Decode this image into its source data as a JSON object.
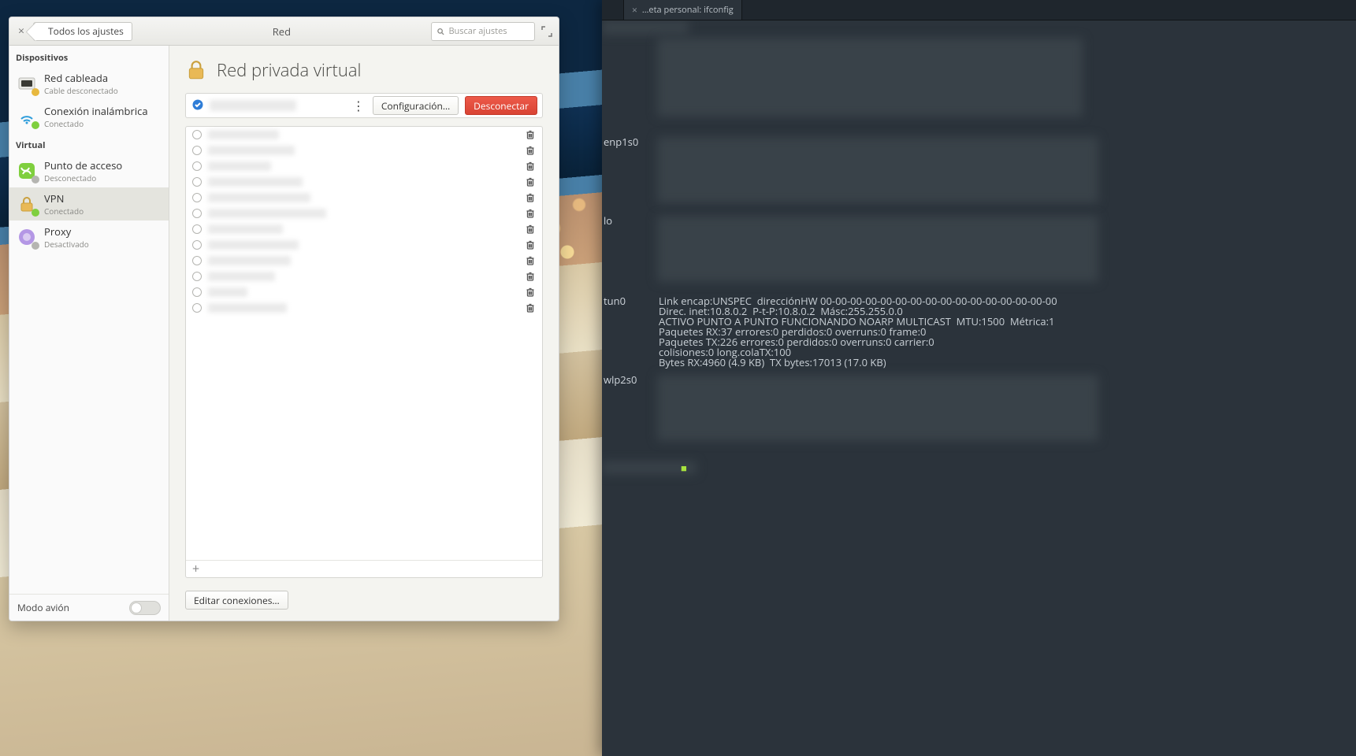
{
  "wallpaper": {
    "style": "bokeh-landscape"
  },
  "network_window": {
    "headerbar": {
      "close_glyph": "×",
      "back_label": "Todos los ajustes",
      "title": "Red",
      "search_placeholder": "Buscar ajustes",
      "maximize_tooltip": "Maximizar"
    },
    "sidebar": {
      "group_devices": "Dispositivos",
      "group_virtual": "Virtual",
      "items": [
        {
          "id": "wired",
          "name": "Red cableada",
          "sub": "Cable desconectado",
          "group": "devices",
          "icon": "ethernet",
          "badge": "#e7b83e"
        },
        {
          "id": "wifi",
          "name": "Conexión inalámbrica",
          "sub": "Conectado",
          "group": "devices",
          "icon": "wifi",
          "badge": "#7fcf3e"
        },
        {
          "id": "hotspot",
          "name": "Punto de acceso",
          "sub": "Desconectado",
          "group": "virtual",
          "icon": "hotspot",
          "badge": "#b5b5b1"
        },
        {
          "id": "vpn",
          "name": "VPN",
          "sub": "Conectado",
          "group": "virtual",
          "icon": "lock",
          "badge": "#7fcf3e",
          "selected": true
        },
        {
          "id": "proxy",
          "name": "Proxy",
          "sub": "Desactivado",
          "group": "virtual",
          "icon": "proxy",
          "badge": "#b5b5b1"
        }
      ],
      "airplane_label": "Modo avión",
      "airplane_on": false
    },
    "main": {
      "page_title": "Red privada virtual",
      "active_connection": {
        "checked": true,
        "name_obscured": true
      },
      "menu_dots_glyph": "⋮",
      "config_button": "Configuración…",
      "disconnect_button": "Desconectar",
      "vpn_rows_count": 12,
      "add_glyph": "+",
      "edit_connections": "Editar conexiones…"
    }
  },
  "terminal_window": {
    "tabs": {
      "title": "…eta personal: ifconfig",
      "close_glyph": "×",
      "new_glyph": "+"
    },
    "interfaces": {
      "enp1s0": "enp1s0",
      "lo": "lo",
      "tun0": "tun0",
      "wlp2s0": "wlp2s0"
    },
    "tun0_lines": [
      "Link encap:UNSPEC  direcciónHW 00-00-00-00-00-00-00-00-00-00-00-00-00-00-00-00",
      "Direc. inet:10.8.0.2  P-t-P:10.8.0.2  Másc:255.255.0.0",
      "ACTIVO PUNTO A PUNTO FUNCIONANDO NOARP MULTICAST  MTU:1500  Métrica:1",
      "Paquetes RX:37 errores:0 perdidos:0 overruns:0 frame:0",
      "Paquetes TX:226 errores:0 perdidos:0 overruns:0 carrier:0",
      "colisiones:0 long.colaTX:100",
      "Bytes RX:4960 (4.9 KB)  TX bytes:17013 (17.0 KB)"
    ]
  }
}
